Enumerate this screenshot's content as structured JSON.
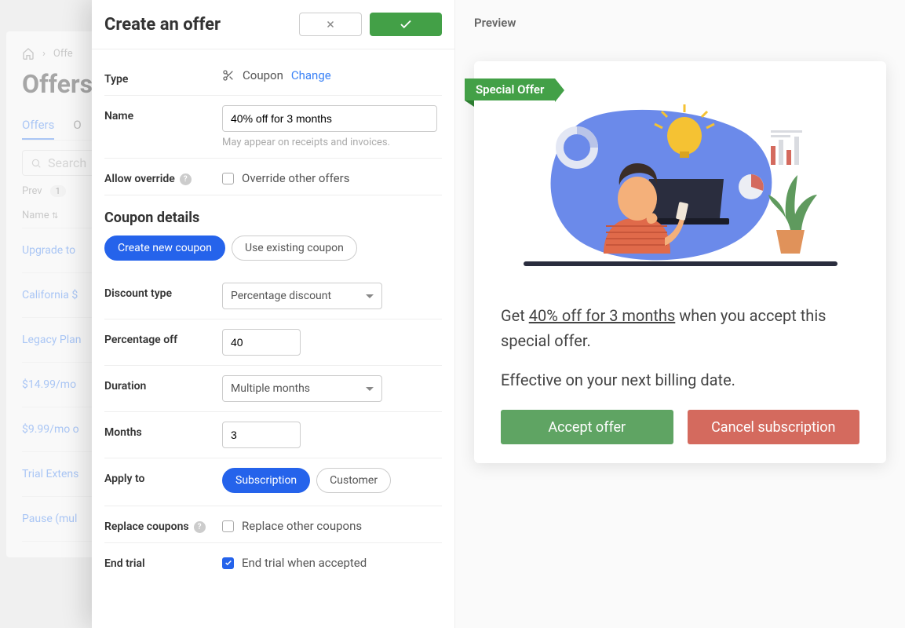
{
  "bg": {
    "breadcrumb_item": "Offe",
    "h1": "Offers",
    "tabs": {
      "active": "Offers",
      "other": "O"
    },
    "search_placeholder": "Search",
    "pager_prev": "Prev",
    "pager_page": "1",
    "th_name": "Name",
    "rows": [
      "Upgrade to",
      "California $",
      "Legacy Plan",
      "$14.99/mo",
      "$9.99/mo o",
      "Trial Extens",
      "Pause (mul"
    ]
  },
  "drawer": {
    "title": "Create an offer",
    "preview_label": "Preview",
    "type_label": "Type",
    "type_value": "Coupon",
    "change": "Change",
    "name_label": "Name",
    "name_value": "40% off for 3 months",
    "name_hint": "May appear on receipts and invoices.",
    "override_label": "Allow override",
    "override_text": "Override other offers",
    "section_title": "Coupon details",
    "pill_create": "Create new coupon",
    "pill_existing": "Use existing coupon",
    "discount_type_label": "Discount type",
    "discount_type_value": "Percentage discount",
    "pct_label": "Percentage off",
    "pct_value": "40",
    "duration_label": "Duration",
    "duration_value": "Multiple months",
    "months_label": "Months",
    "months_value": "3",
    "apply_label": "Apply to",
    "apply_sub": "Subscription",
    "apply_cust": "Customer",
    "replace_label": "Replace coupons",
    "replace_text": "Replace other coupons",
    "endtrial_label": "End trial",
    "endtrial_text": "End trial when accepted"
  },
  "preview": {
    "ribbon": "Special Offer",
    "line1_pre": "Get ",
    "line1_u": "40% off for 3 months",
    "line1_post": " when you accept this special offer.",
    "line2": "Effective on your next billing date.",
    "accept": "Accept offer",
    "cancel": "Cancel subscription"
  }
}
